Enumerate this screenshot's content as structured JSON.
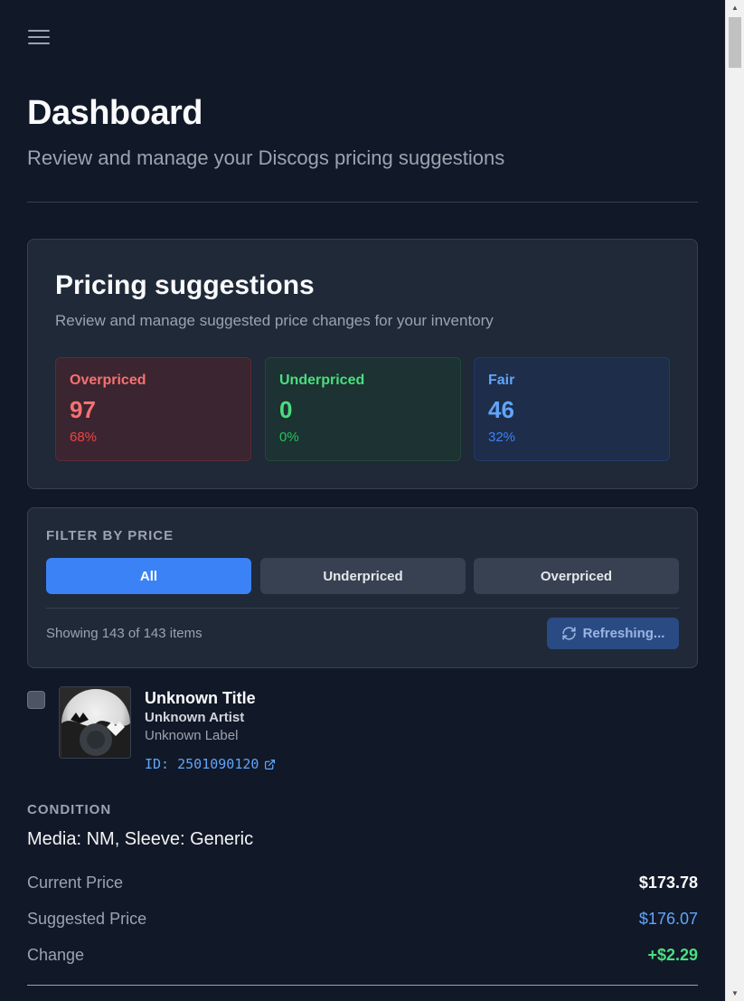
{
  "header": {
    "title": "Dashboard",
    "subtitle": "Review and manage your Discogs pricing suggestions"
  },
  "summary": {
    "title": "Pricing suggestions",
    "description": "Review and manage suggested price changes for your inventory",
    "stats": {
      "overpriced": {
        "label": "Overpriced",
        "count": "97",
        "percent": "68%"
      },
      "underpriced": {
        "label": "Underpriced",
        "count": "0",
        "percent": "0%"
      },
      "fair": {
        "label": "Fair",
        "count": "46",
        "percent": "32%"
      }
    }
  },
  "filter": {
    "heading": "FILTER BY PRICE",
    "options": [
      "All",
      "Underpriced",
      "Overpriced"
    ],
    "selected": "All",
    "showing": "Showing 143 of 143 items",
    "refresh_label": "Refreshing..."
  },
  "item": {
    "title": "Unknown Title",
    "artist": "Unknown Artist",
    "label": "Unknown Label",
    "id": "ID: 2501090120",
    "condition_heading": "CONDITION",
    "condition": "Media: NM, Sleeve: Generic",
    "current_price_label": "Current Price",
    "current_price": "$173.78",
    "suggested_price_label": "Suggested Price",
    "suggested_price": "$176.07",
    "change_label": "Change",
    "change": "+$2.29"
  },
  "colors": {
    "background": "#111827",
    "card": "#1f2937",
    "accent": "#3b82f6",
    "overpriced": "#f87171",
    "underpriced": "#4ade80",
    "fair": "#60a5fa"
  },
  "icons": {
    "menu": "hamburger-menu-icon",
    "refresh": "refresh-icon",
    "external": "external-link-icon"
  }
}
